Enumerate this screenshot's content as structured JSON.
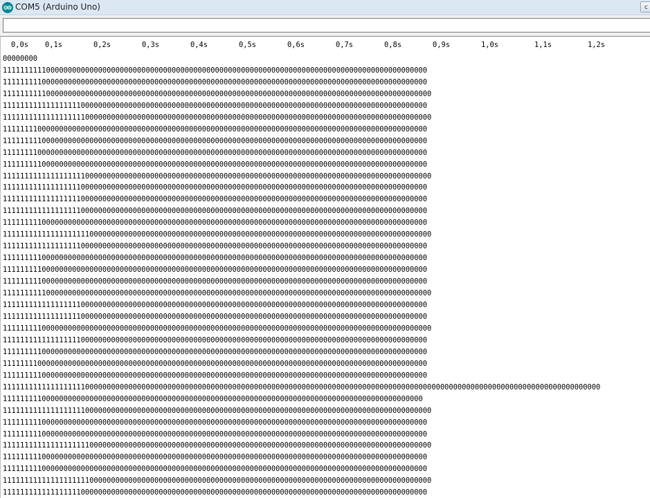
{
  "window": {
    "title": "COM5 (Arduino Uno)",
    "send_button_fragment": "c"
  },
  "send_field": {
    "value": ""
  },
  "monitor": {
    "time_ticks": [
      "0,0s",
      "0,1s",
      "0,2s",
      "0,3s",
      "0,4s",
      "0,5s",
      "0,6s",
      "0,7s",
      "0,8s",
      "0,9s",
      "1,0s",
      "1,1s",
      "1,2s"
    ],
    "lines": [
      "00000000",
      "11111111110000000000000000000000000000000000000000000000000000000000000000000000000000000000000000",
      "11111111100000000000000000000000000000000000000000000000000000000000000000000000000000000000000000",
      "111111111100000000000000000000000000000000000000000000000000000000000000000000000000000000000000000",
      "11111111111111111100000000000000000000000000000000000000000000000000000000000000000000000000000000",
      "111111111111111111100000000000000000000000000000000000000000000000000000000000000000000000000000000",
      "11111111000000000000000000000000000000000000000000000000000000000000000000000000000000000000000000",
      "11111111100000000000000000000000000000000000000000000000000000000000000000000000000000000000000000",
      "11111111000000000000000000000000000000000000000000000000000000000000000000000000000000000000000000",
      "11111111100000000000000000000000000000000000000000000000000000000000000000000000000000000000000000",
      "111111111111111111100000000000000000000000000000000000000000000000000000000000000000000000000000000",
      "11111111111111111100000000000000000000000000000000000000000000000000000000000000000000000000000000",
      "11111111111111111100000000000000000000000000000000000000000000000000000000000000000000000000000000",
      "11111111111111111100000000000000000000000000000000000000000000000000000000000000000000000000000000",
      "11111111100000000000000000000000000000000000000000000000000000000000000000000000000000000000000000",
      "111111111111111111110000000000000000000000000000000000000000000000000000000000000000000000000000000",
      "11111111111111111100000000000000000000000000000000000000000000000000000000000000000000000000000000",
      "11111111100000000000000000000000000000000000000000000000000000000000000000000000000000000000000000",
      "11111111100000000000000000000000000000000000000000000000000000000000000000000000000000000000000000",
      "11111111100000000000000000000000000000000000000000000000000000000000000000000000000000000000000000",
      "111111111100000000000000000000000000000000000000000000000000000000000000000000000000000000000000000",
      "11111111111111111100000000000000000000000000000000000000000000000000000000000000000000000000000000",
      "11111111111111111100000000000000000000000000000000000000000000000000000000000000000000000000000000",
      "111111111000000000000000000000000000000000000000000000000000000000000000000000000000000000000000000",
      "11111111111111111100000000000000000000000000000000000000000000000000000000000000000000000000000000",
      "11111111100000000000000000000000000000000000000000000000000000000000000000000000000000000000000000",
      "11111111000000000000000000000000000000000000000000000000000000000000000000000000000000000000000000",
      "11111111100000000000000000000000000000000000000000000000000000000000000000000000000000000000000000",
      "111111111111111111100000000000000000000000000000000000000000000000000000000000000000000000000000000000000000000000000000000000000000000000",
      "1111111110000000000000000000000000000000000000000000000000000000000000000000000000000000000000000",
      "111111111111111111100000000000000000000000000000000000000000000000000000000000000000000000000000000",
      "11111111100000000000000000000000000000000000000000000000000000000000000000000000000000000000000000",
      "11111111100000000000000000000000000000000000000000000000000000000000000000000000000000000000000000",
      "111111111111111111110000000000000000000000000000000000000000000000000000000000000000000000000000000",
      "11111111100000000000000000000000000000000000000000000000000000000000000000000000000000000000000000",
      "11111111100000000000000000000000000000000000000000000000000000000000000000000000000000000000000000",
      "111111111111111111110000000000000000000000000000000000000000000000000000000000000000000000000000000",
      "11111111111111111100000000000000000000000000000000000000000000000000000000000000000000000000000000"
    ]
  }
}
